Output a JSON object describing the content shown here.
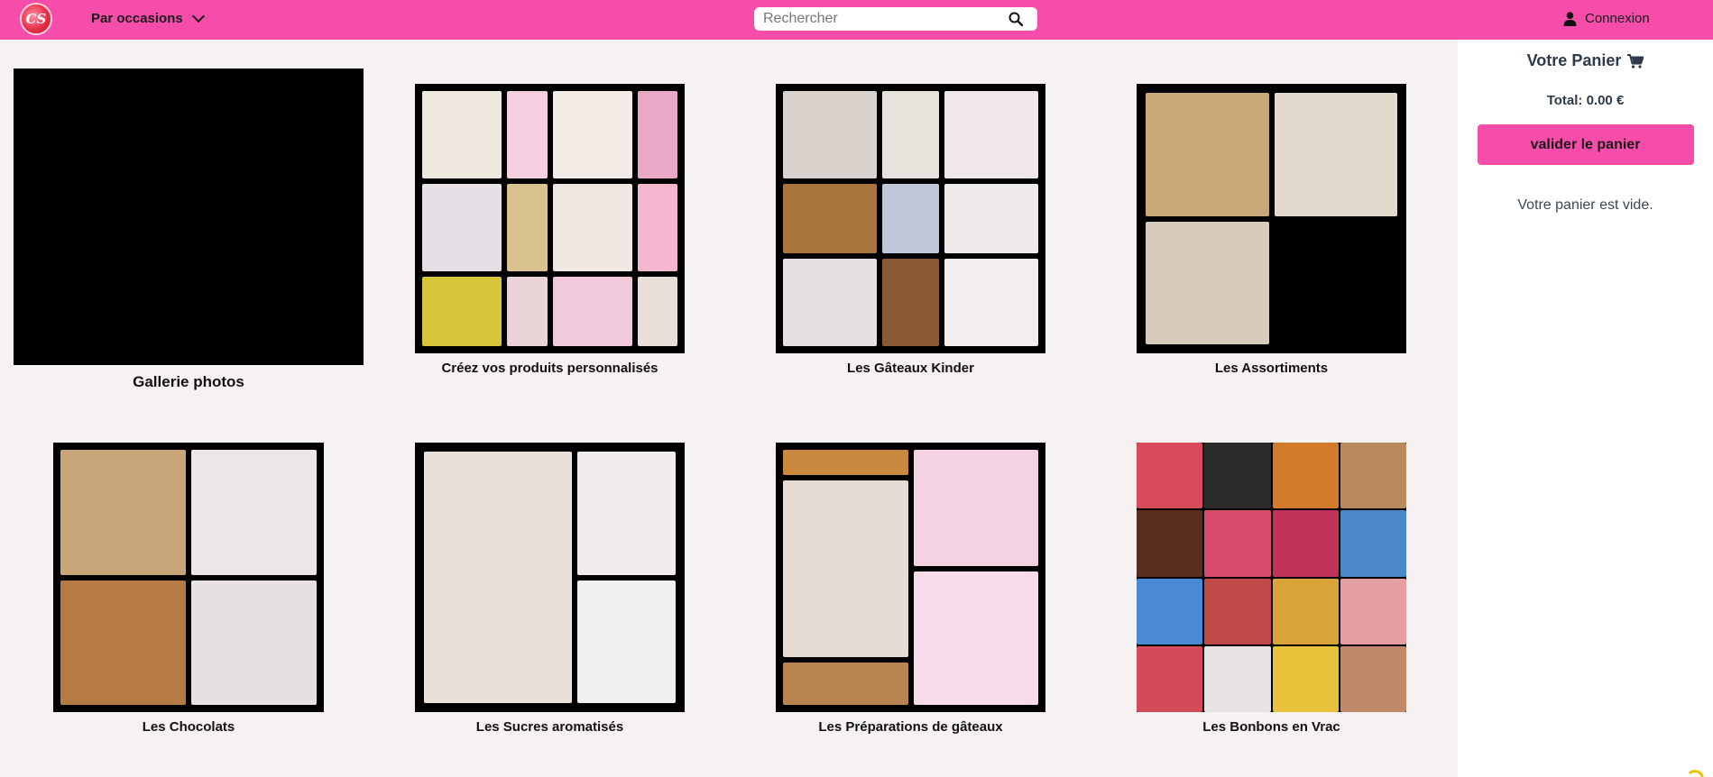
{
  "header": {
    "logo_alt": "CS",
    "occasions_label": "Par occasions",
    "search_placeholder": "Rechercher",
    "login_label": "Connexion",
    "brand_color": "#f74daa"
  },
  "categories": [
    {
      "label": "Gallerie photos"
    },
    {
      "label": "Créez vos produits personnalisés"
    },
    {
      "label": "Les Gâteaux Kinder"
    },
    {
      "label": "Les Assortiments"
    },
    {
      "label": "Les Chocolats"
    },
    {
      "label": "Les Sucres aromatisés"
    },
    {
      "label": "Les Préparations de gâteaux"
    },
    {
      "label": "Les Bonbons en Vrac"
    }
  ],
  "cart": {
    "title": "Votre Panier",
    "total": "Total: 0.00 €",
    "validate_label": "valider le panier",
    "empty_message": "Votre panier est vide."
  }
}
